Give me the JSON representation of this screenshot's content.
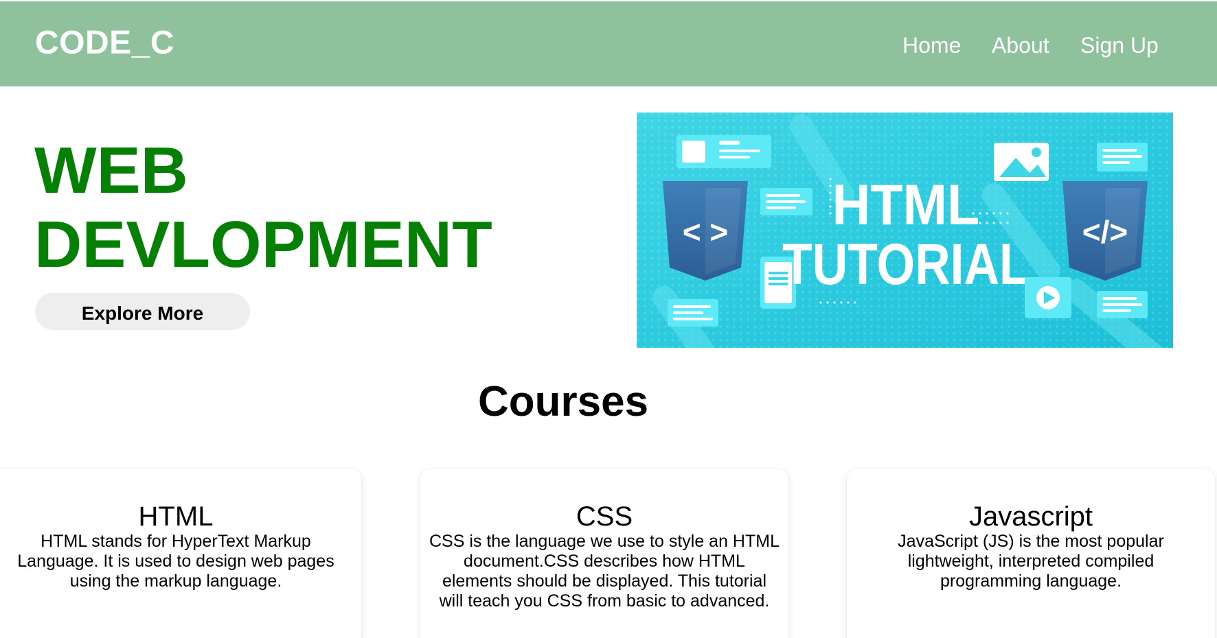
{
  "navbar": {
    "brand": "CODE_C",
    "links": [
      {
        "label": "Home"
      },
      {
        "label": "About"
      },
      {
        "label": "Sign Up"
      }
    ],
    "background": "#8fc29c"
  },
  "hero": {
    "title_line1": "WEB",
    "title_line2": "DEVLOPMENT",
    "title_color": "#058005",
    "button_label": "Explore More"
  },
  "banner": {
    "line1": "HTML",
    "line2": "TUTORIAL",
    "left_badge": "< >",
    "right_badge": "</>"
  },
  "courses": {
    "title": "Courses",
    "items": [
      {
        "name": "HTML",
        "description": "HTML stands for HyperText Markup Language. It is used to design web pages using the markup language."
      },
      {
        "name": "CSS",
        "description": "CSS is the language we use to style an HTML document.CSS describes how HTML elements should be displayed. This tutorial will teach you CSS from basic to advanced."
      },
      {
        "name": "Javascript",
        "description": "JavaScript (JS) is the most popular lightweight, interpreted compiled programming language."
      }
    ]
  }
}
